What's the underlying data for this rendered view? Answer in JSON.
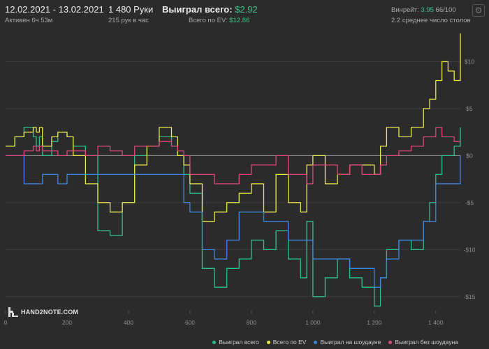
{
  "header": {
    "date_range": "12.02.2021 - 13.02.2021",
    "active_time": "Активен 6ч 53м",
    "hands": "1 480 Руки",
    "hands_per_hour": "215 рук в час",
    "won_total_label": "Выиграл всего:",
    "won_total_value": "$2.92",
    "ev_total_label": "Всего по EV:",
    "ev_total_value": "$12.86",
    "winrate_label": "Винрейт:",
    "winrate_value": "3.95",
    "winrate_count": "66/100",
    "avg_tables": "2.2 среднее число столов"
  },
  "logo_text": "HAND2NOTE.COM",
  "colors": {
    "green": "#2fbf8a",
    "yellow": "#e8e84a",
    "blue": "#3f86e0",
    "pink": "#e0457e",
    "grid": "#3c3c3c",
    "zero": "#9a9a9a",
    "background": "#2b2b2b"
  },
  "chart_data": {
    "type": "line",
    "x_ticks": [
      "0",
      "200",
      "400",
      "600",
      "800",
      "1 000",
      "1 200",
      "1 400"
    ],
    "x_tick_values": [
      0,
      200,
      400,
      600,
      800,
      1000,
      1200,
      1400
    ],
    "y_ticks": [
      "$10",
      "$5",
      "$0",
      "-$5",
      "-$10",
      "-$15"
    ],
    "y_tick_values": [
      10,
      5,
      0,
      -5,
      -10,
      -15
    ],
    "xlim": [
      0,
      1480
    ],
    "ylim": [
      -16.5,
      13
    ],
    "grid": true,
    "legend_position": "bottom-right",
    "series": [
      {
        "name": "Выиграл всего",
        "color_key": "green",
        "x": [
          0,
          30,
          60,
          90,
          100,
          110,
          120,
          150,
          170,
          200,
          220,
          260,
          300,
          340,
          380,
          420,
          460,
          500,
          540,
          560,
          580,
          600,
          640,
          680,
          720,
          760,
          800,
          840,
          880,
          920,
          960,
          980,
          1000,
          1040,
          1080,
          1120,
          1160,
          1200,
          1220,
          1240,
          1280,
          1320,
          1360,
          1380,
          1400,
          1420,
          1440,
          1460,
          1480
        ],
        "y": [
          1,
          2,
          3,
          2,
          1,
          2,
          0,
          1.5,
          2.5,
          2,
          1,
          0,
          -8,
          -8.5,
          -5,
          0,
          1,
          2,
          1,
          0,
          -2,
          -4,
          -12,
          -14,
          -12,
          -11,
          -9,
          -10,
          -8,
          -11,
          -13,
          -7,
          -15,
          -13,
          -11,
          -13,
          -14,
          -16,
          -13,
          -10,
          -9,
          -10,
          -7,
          -5,
          -2,
          0,
          0,
          1,
          3
        ]
      },
      {
        "name": "Всего по EV",
        "color_key": "yellow",
        "x": [
          0,
          30,
          60,
          90,
          100,
          110,
          120,
          150,
          170,
          200,
          220,
          260,
          300,
          340,
          380,
          420,
          460,
          500,
          540,
          560,
          580,
          600,
          640,
          680,
          720,
          760,
          800,
          840,
          880,
          920,
          960,
          980,
          1000,
          1040,
          1080,
          1120,
          1160,
          1200,
          1220,
          1240,
          1280,
          1320,
          1360,
          1380,
          1400,
          1420,
          1440,
          1460,
          1480
        ],
        "y": [
          1,
          2,
          2.5,
          3,
          2.5,
          3,
          1,
          2,
          2.5,
          2,
          0,
          -3,
          -5,
          -6,
          -5,
          -1,
          1,
          3,
          2,
          0,
          -1,
          -3,
          -7,
          -6,
          -5,
          -4,
          -3,
          -6,
          -2,
          -5,
          -6,
          -1,
          0,
          -3,
          -2,
          -1,
          -1,
          -2,
          1,
          3,
          2,
          3,
          5,
          6,
          8,
          10,
          9,
          8,
          13
        ]
      },
      {
        "name": "Выиграл на шоудауне",
        "color_key": "blue",
        "x": [
          0,
          30,
          60,
          90,
          100,
          110,
          120,
          150,
          170,
          200,
          220,
          260,
          300,
          340,
          380,
          420,
          460,
          500,
          540,
          560,
          580,
          600,
          640,
          680,
          720,
          760,
          800,
          840,
          880,
          920,
          960,
          980,
          1000,
          1040,
          1080,
          1120,
          1160,
          1200,
          1220,
          1240,
          1280,
          1320,
          1360,
          1380,
          1400,
          1420,
          1440,
          1460,
          1480
        ],
        "y": [
          0,
          0,
          -3,
          -3,
          -3,
          -3,
          -2,
          -2,
          -3,
          -2,
          -2,
          -2,
          -2,
          -2,
          -2,
          -2,
          -2,
          -2,
          -2,
          -2,
          -5,
          -6,
          -10,
          -11,
          -9,
          -6,
          -6,
          -7,
          -7,
          -9,
          -9,
          -9,
          -11,
          -11,
          -11,
          -12,
          -12,
          -14,
          -13,
          -11,
          -9,
          -9,
          -7,
          -7,
          -3,
          -3,
          -3,
          -3,
          0
        ]
      },
      {
        "name": "Выиграл без шоудауна",
        "color_key": "pink",
        "x": [
          0,
          30,
          60,
          90,
          100,
          110,
          120,
          150,
          170,
          200,
          220,
          260,
          300,
          340,
          380,
          420,
          460,
          500,
          540,
          560,
          580,
          600,
          640,
          680,
          720,
          760,
          800,
          840,
          880,
          920,
          960,
          980,
          1000,
          1040,
          1080,
          1120,
          1160,
          1200,
          1220,
          1240,
          1280,
          1320,
          1360,
          1380,
          1400,
          1420,
          1440,
          1460,
          1480
        ],
        "y": [
          0,
          0,
          0.5,
          1,
          0.5,
          1,
          0.5,
          0.5,
          0,
          0.5,
          0.5,
          0,
          1,
          0.5,
          0,
          1,
          1,
          1.5,
          1,
          0.5,
          0,
          -2,
          -2,
          -3,
          -3,
          -2,
          -1,
          -1,
          0,
          -2,
          -2,
          -3,
          -1,
          -1,
          -2,
          -1,
          -2,
          -2,
          -1,
          0,
          0.5,
          1,
          2,
          2,
          3,
          2,
          2,
          1.5,
          1.5
        ]
      }
    ]
  }
}
